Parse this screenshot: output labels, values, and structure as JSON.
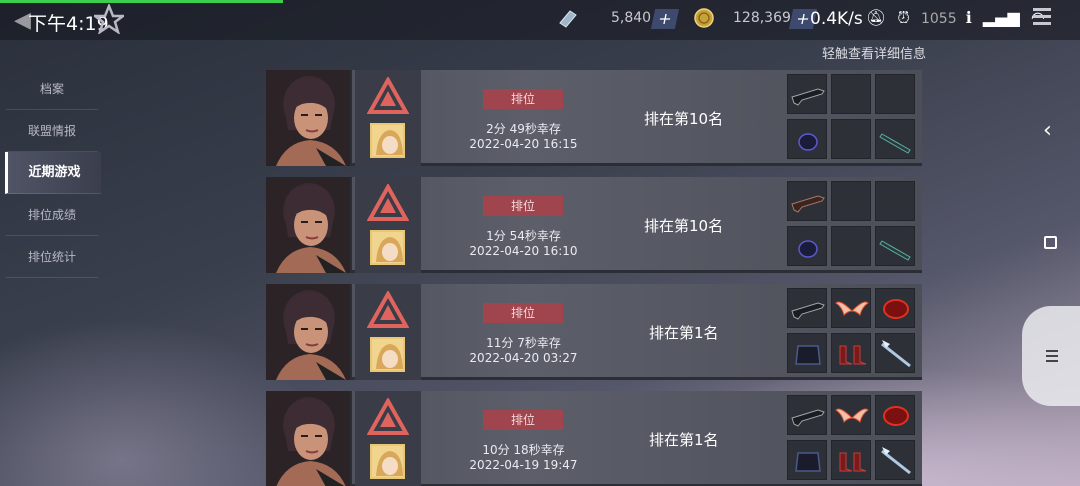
{
  "status_bar": {
    "time": "下午4:19",
    "gems": "5,840",
    "coins": "128,369",
    "network": "0.4K/s",
    "battery_partial": "1055"
  },
  "hint": "轻触查看详细信息",
  "sidebar": {
    "items": [
      {
        "label": "档案",
        "active": false
      },
      {
        "label": "联盟情报",
        "active": false
      },
      {
        "label": "近期游戏",
        "active": true
      },
      {
        "label": "排位成绩",
        "active": false
      },
      {
        "label": "排位统计",
        "active": false
      }
    ]
  },
  "games": [
    {
      "mode": "排位",
      "survival": "2分 49秒幸存",
      "date": "2022-04-20 16:15",
      "rank": "排在第10名",
      "items": [
        "gun",
        "empty",
        "empty",
        "glove",
        "empty",
        "blade"
      ]
    },
    {
      "mode": "排位",
      "survival": "1分 54秒幸存",
      "date": "2022-04-20 16:10",
      "rank": "排在第10名",
      "items": [
        "gun-rust",
        "empty",
        "empty",
        "glove",
        "empty",
        "blade"
      ]
    },
    {
      "mode": "排位",
      "survival": "11分 7秒幸存",
      "date": "2022-04-20 03:27",
      "rank": "排在第1名",
      "items": [
        "gun",
        "wings",
        "ruby",
        "armor",
        "boots",
        "spear"
      ]
    },
    {
      "mode": "排位",
      "survival": "10分 18秒幸存",
      "date": "2022-04-19 19:47",
      "rank": "排在第1名",
      "items": [
        "gun",
        "wings",
        "ruby",
        "armor",
        "boots",
        "spear"
      ]
    }
  ],
  "colors": {
    "badge": "#a0454e",
    "accent_green": "#3ccf4e"
  }
}
